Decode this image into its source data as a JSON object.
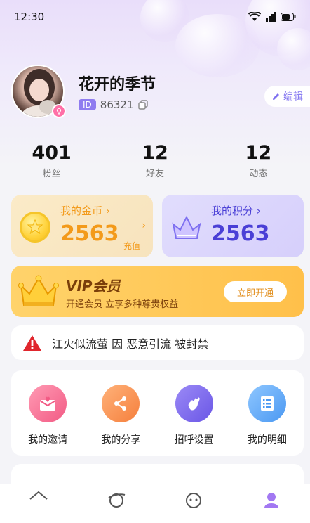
{
  "status_bar": {
    "time": "12:30"
  },
  "profile": {
    "username": "花开的季节",
    "id_tag": "ID",
    "id_value": "86321",
    "edit_label": "编辑"
  },
  "stats": [
    {
      "value": "401",
      "label": "粉丝"
    },
    {
      "value": "12",
      "label": "好友"
    },
    {
      "value": "12",
      "label": "动态"
    }
  ],
  "coins": {
    "title": "我的金币",
    "value": "2563",
    "recharge_label": "充值"
  },
  "points": {
    "title": "我的积分",
    "value": "2563"
  },
  "vip": {
    "title": "VIP会员",
    "subtitle": "开通会员 立享多种尊贵权益",
    "button_label": "立即开通"
  },
  "notice": {
    "text": "江火似流萤 因 恶意引流 被封禁"
  },
  "actions": [
    {
      "label": "我的邀请",
      "icon": "invite-envelope-icon"
    },
    {
      "label": "我的分享",
      "icon": "share-icon"
    },
    {
      "label": "招呼设置",
      "icon": "wave-hand-icon"
    },
    {
      "label": "我的明细",
      "icon": "list-details-icon"
    }
  ],
  "tabbar": [
    "home-icon",
    "discover-planet-icon",
    "message-icon",
    "profile-icon"
  ],
  "colors": {
    "accent": "#7d6ff0",
    "coin": "#f39a1a",
    "points": "#4a3fd6",
    "vip_text": "#7a3e0a"
  }
}
